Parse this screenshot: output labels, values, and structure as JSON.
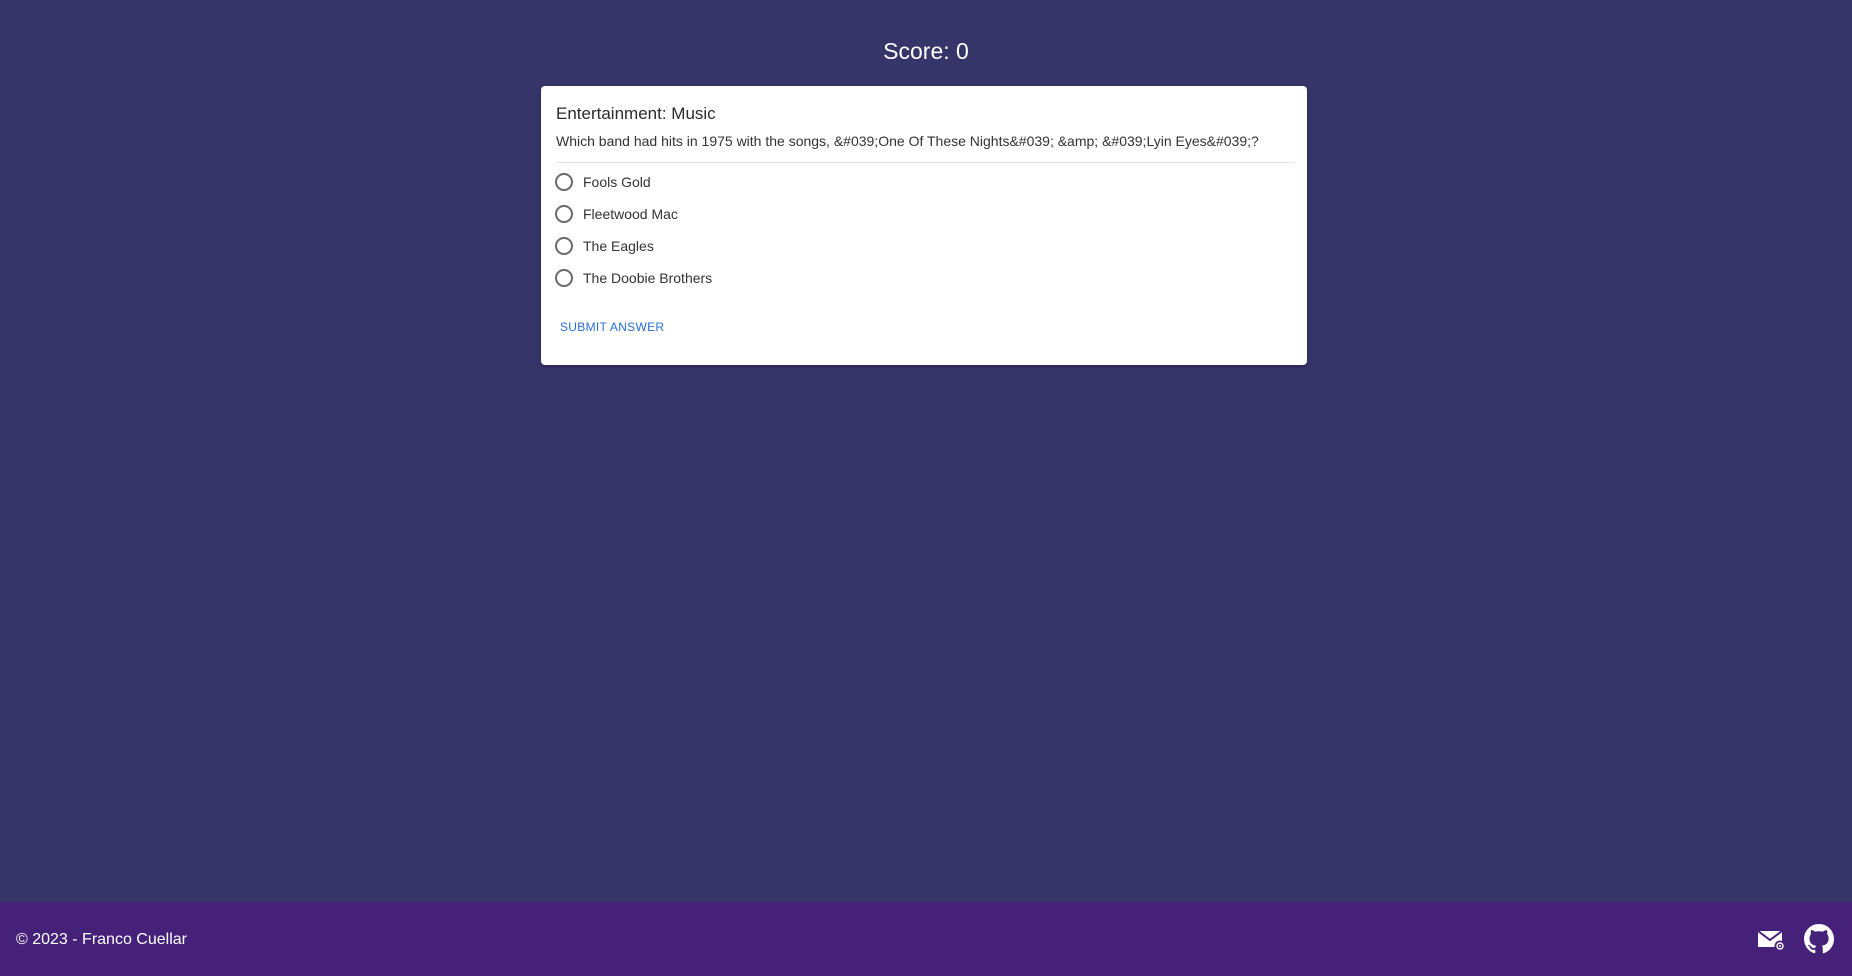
{
  "score": {
    "text": "Score: 0"
  },
  "card": {
    "category": "Entertainment: Music",
    "question": "Which band had hits in 1975 with the songs, &#039;One Of These Nights&#039; &amp; &#039;Lyin Eyes&#039;?",
    "options": [
      {
        "label": "Fools Gold",
        "selected": false
      },
      {
        "label": "Fleetwood Mac",
        "selected": false
      },
      {
        "label": "The Eagles",
        "selected": false
      },
      {
        "label": "The Doobie Brothers",
        "selected": false
      }
    ],
    "submit_label": "SUBMIT ANSWER"
  },
  "footer": {
    "copyright": "© 2023 - Franco Cuellar",
    "icons": [
      "email-icon",
      "github-icon"
    ]
  },
  "colors": {
    "background": "#36356a",
    "footer": "#46217a",
    "card": "#ffffff",
    "link": "#2a6fd6"
  }
}
